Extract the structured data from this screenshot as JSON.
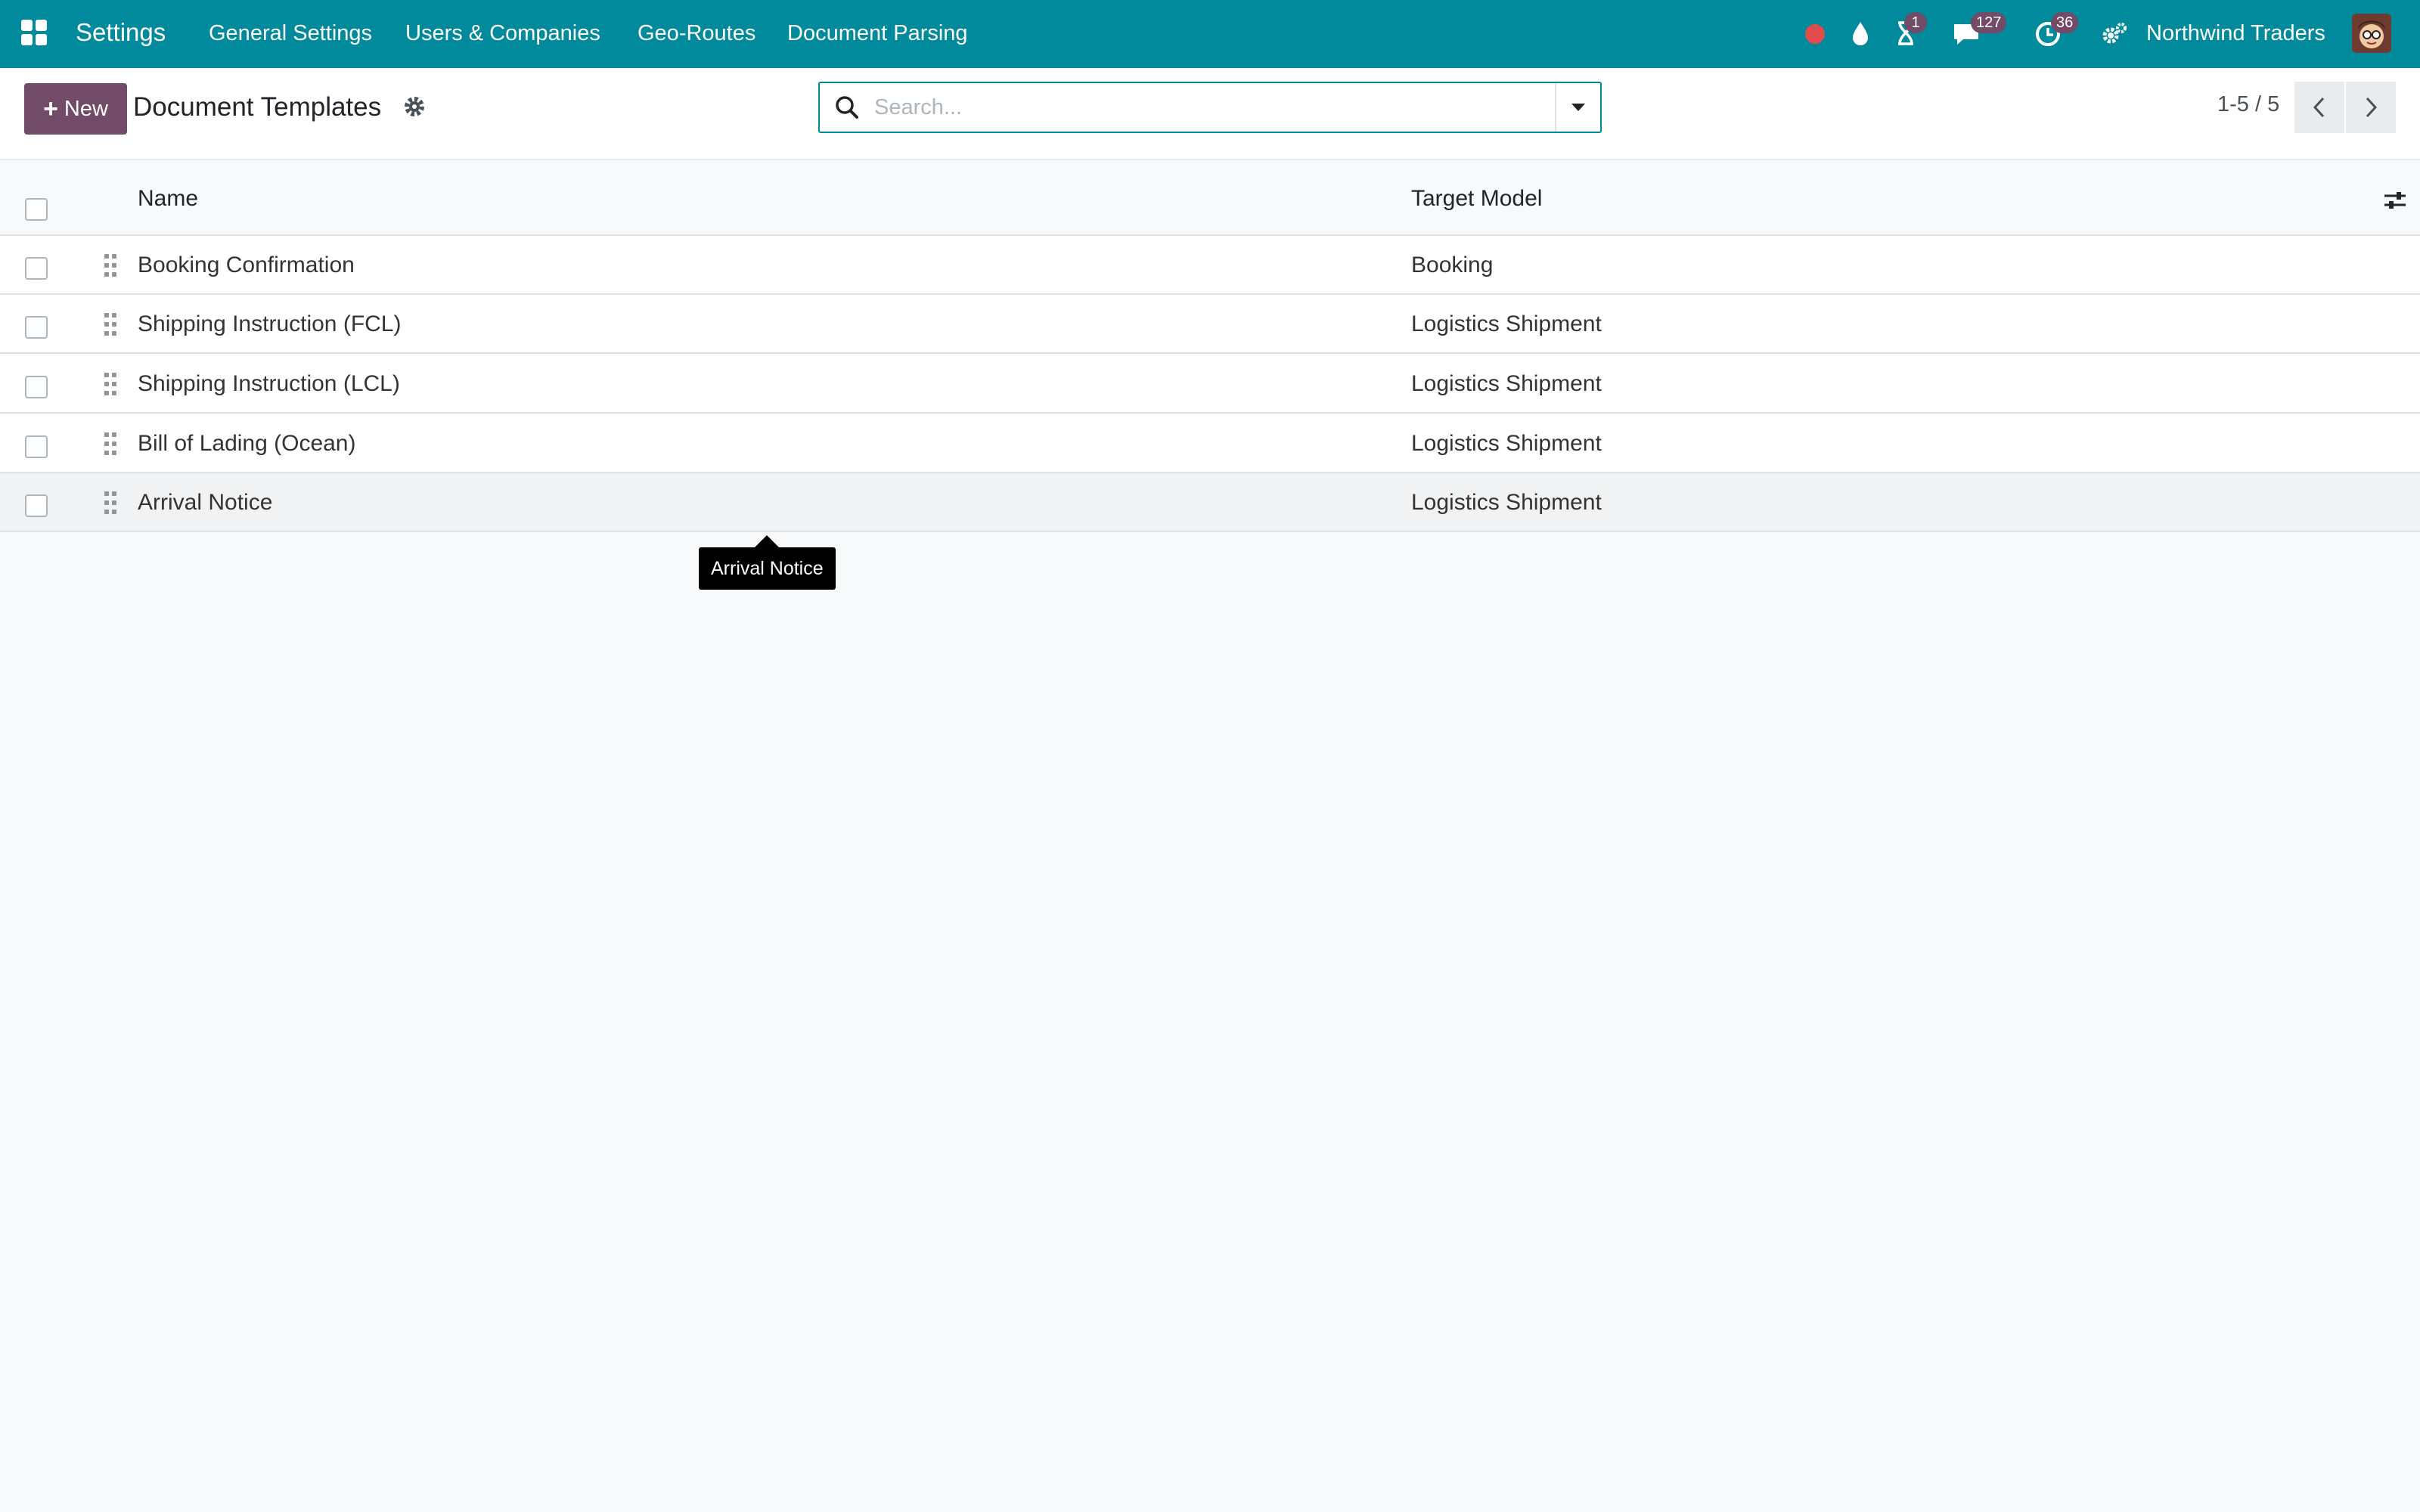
{
  "navbar": {
    "app_name": "Settings",
    "menu": [
      "General Settings",
      "Users & Companies",
      "Geo-Routes",
      "Document Parsing"
    ],
    "badges": {
      "activities": "1",
      "messages": "127",
      "timesheet": "36"
    },
    "company": "Northwind Traders",
    "colors": {
      "background": "#018a9b",
      "badge": "#714b67",
      "status_dot": "#e14b4b"
    },
    "icons": [
      "apps-grid-icon",
      "status-dot-icon",
      "drop-icon",
      "hourglass-icon",
      "chat-icon",
      "clock-icon",
      "gears-icon"
    ]
  },
  "control_panel": {
    "new_label": "New",
    "title": "Document Templates",
    "search_placeholder": "Search...",
    "pager": "1-5 / 5",
    "accent": "#714b67"
  },
  "table": {
    "columns": [
      "Name",
      "Target Model"
    ],
    "rows": [
      {
        "name": "Booking Confirmation",
        "model": "Booking"
      },
      {
        "name": "Shipping Instruction (FCL)",
        "model": "Logistics Shipment"
      },
      {
        "name": "Shipping Instruction (LCL)",
        "model": "Logistics Shipment"
      },
      {
        "name": "Bill of Lading (Ocean)",
        "model": "Logistics Shipment"
      },
      {
        "name": "Arrival Notice",
        "model": "Logistics Shipment"
      }
    ]
  },
  "tooltip": {
    "text": "Arrival Notice"
  }
}
